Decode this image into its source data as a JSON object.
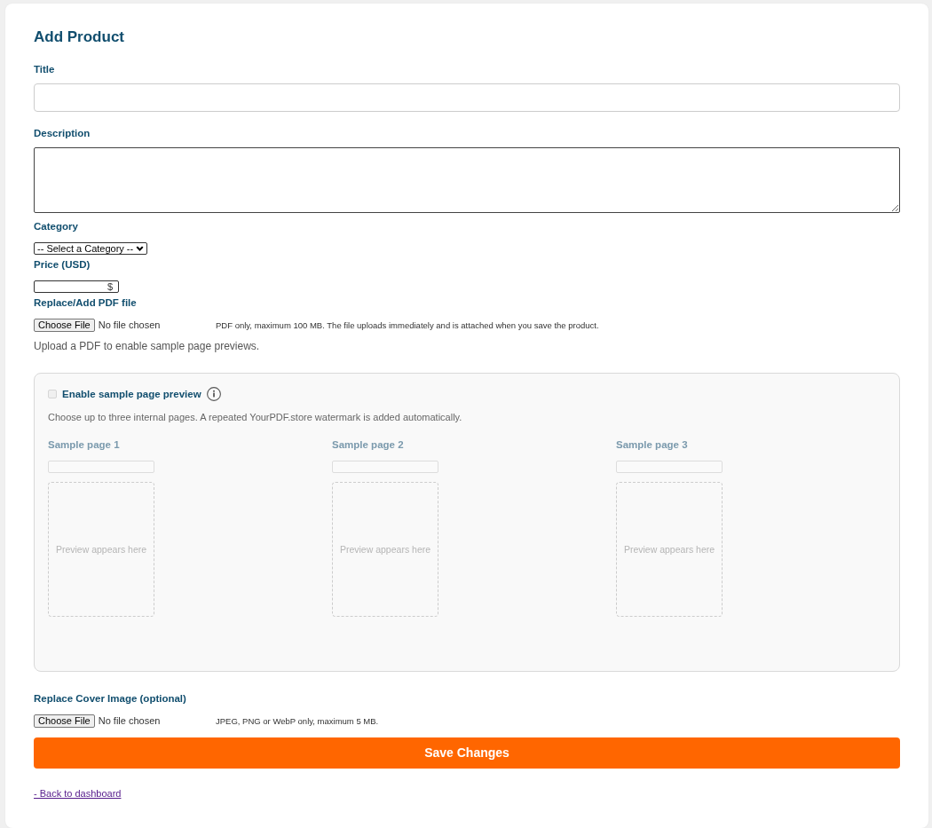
{
  "heading": "Add Product",
  "fields": [
    {
      "kind": "text",
      "label": "Title"
    },
    {
      "kind": "textarea",
      "label": "Description"
    },
    {
      "kind": "select",
      "label": "Category",
      "value": "-- Select a Category --"
    },
    {
      "kind": "price",
      "label": "Price (USD)",
      "suffix": "$"
    },
    {
      "kind": "file",
      "label": "Replace/Add PDF file",
      "button": "Choose File",
      "status": "No file chosen",
      "hint": "PDF only, maximum 100 MB. The file uploads immediately and is attached when you save the product."
    }
  ],
  "pdf_note": "Upload a PDF to enable sample page previews.",
  "sample_preview": {
    "label": "Enable sample page preview",
    "checked": false,
    "disabled": true,
    "description": "Choose up to three internal pages. A repeated YourPDF.store watermark is added automatically.",
    "pages": [
      {
        "label": "Sample page 1",
        "placeholder": "Preview appears here"
      },
      {
        "label": "Sample page 2",
        "placeholder": "Preview appears here"
      },
      {
        "label": "Sample page 3",
        "placeholder": "Preview appears here"
      }
    ]
  },
  "cover_field": {
    "kind": "file",
    "label": "Replace Cover Image (optional)",
    "button": "Choose File",
    "status": "No file chosen",
    "hint": "JPEG, PNG or WebP only, maximum 5 MB."
  },
  "save_button": "Save Changes",
  "back_link": "- Back to dashboard"
}
